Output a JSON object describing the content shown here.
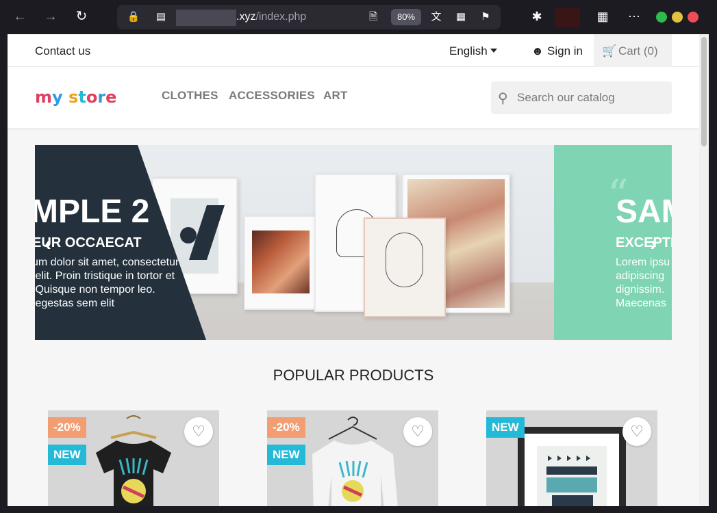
{
  "browser": {
    "url_domain": ".xyz",
    "url_path": "/index.php",
    "zoom": "80%"
  },
  "topnav": {
    "contact": "Contact us",
    "language": "English",
    "signin": "Sign in",
    "cart": "Cart (0)"
  },
  "header": {
    "logo": [
      "m",
      "y",
      " ",
      "s",
      "t",
      "o",
      "r",
      "e"
    ],
    "menu": [
      "CLOTHES",
      "ACCESSORIES",
      "ART"
    ],
    "search_placeholder": "Search our catalog"
  },
  "slider": {
    "slide1": {
      "title": "MPLE 2",
      "subtitle": "EUR OCCAECAT",
      "text": "um dolor sit amet, consectetur\n elit. Proin tristique in tortor et\n Quisque non tempor leo.\n egestas sem elit"
    },
    "slide2": {
      "title": "SAM",
      "subtitle": "EXCEPTE",
      "text": "Lorem ipsu\nadipiscing\ndignissim. \nMaecenas"
    }
  },
  "section_title": "POPULAR PRODUCTS",
  "products": [
    {
      "discount": "-20%",
      "new": "NEW"
    },
    {
      "discount": "-20%",
      "new": "NEW"
    },
    {
      "new": "NEW"
    }
  ],
  "colors": {
    "accent": "#24b9d7",
    "discount": "#f39d72",
    "dark_panel": "#24313d",
    "teal_panel": "#7fd4b3"
  }
}
